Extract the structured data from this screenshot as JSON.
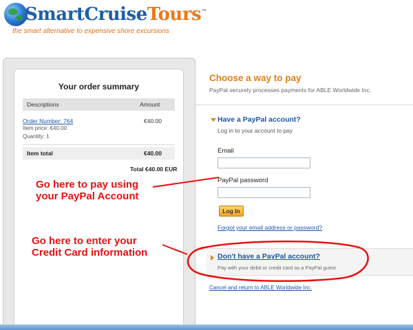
{
  "header": {
    "brand_main": "SmartCruise",
    "brand_tours": "Tours",
    "brand_tm": "™",
    "tagline": "the smart alternative to expensive shore excursions"
  },
  "summary": {
    "title": "Your order summary",
    "col_descriptions": "Descriptions",
    "col_amount": "Amount",
    "order_number": "Order Number: 764",
    "order_amount": "€40.00",
    "item_price": "Item price: €40.00",
    "quantity": "Quantity: 1",
    "item_total_label": "Item total",
    "item_total_value": "€40.00",
    "grand_total": "Total €40.00 EUR"
  },
  "payment": {
    "title": "Choose a way to pay",
    "subtitle": "PayPal securely processes payments for ABLE Worldwide Inc.",
    "have_account_title": "Have a PayPal account?",
    "have_account_sub": "Log in to your account to pay",
    "email_label": "Email",
    "email_value": "",
    "password_label": "PayPal password",
    "password_value": "",
    "login_button": "Log In",
    "forgot_link": "Forgot your email address or password?",
    "no_account_title": "Don't have a PayPal account?",
    "no_account_sub": "Pay with your debit or credit card as a PayPal guest",
    "cancel_link": "Cancel and return to ABLE Worldwide Inc."
  },
  "annotations": {
    "paypal_line1": "Go here to pay using",
    "paypal_line2": "your PayPal Account",
    "card_line1": "Go here to enter your",
    "card_line2": "Credit Card information"
  },
  "colors": {
    "accent_orange": "#e0801a",
    "link_blue": "#1b57a6",
    "annotation_red": "#e81010"
  },
  "icons": [
    "globe-logo-icon",
    "arrow-down-icon",
    "arrow-right-icon"
  ]
}
